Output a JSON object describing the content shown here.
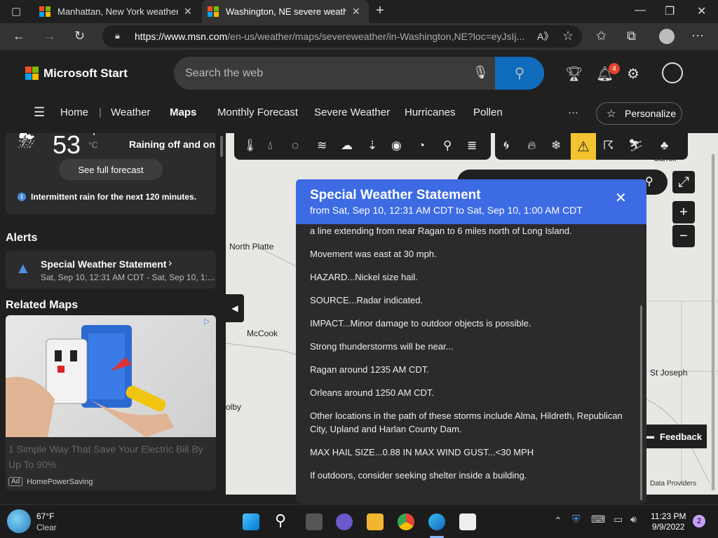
{
  "browser": {
    "tabs": [
      {
        "title": "Manhattan, New York weather fo",
        "active": false
      },
      {
        "title": "Washington, NE severe weather",
        "active": true
      }
    ],
    "new_tab": "+",
    "url_host": "https://www.msn.com",
    "url_path": "/en-us/weather/maps/severeweather/in-Washington,NE?loc=eyJsIj..."
  },
  "header": {
    "brand": "Microsoft Start",
    "search_placeholder": "Search the web",
    "notifications_count": "4",
    "nav": [
      "Home",
      "Weather",
      "Maps",
      "Monthly Forecast",
      "Severe Weather",
      "Hurricanes",
      "Pollen"
    ],
    "nav_active": "Maps",
    "more": "···",
    "personalize": "Personalize"
  },
  "current": {
    "temp": "53",
    "unit_f": "°F",
    "unit_c": "°C",
    "condition": "Raining off and on",
    "forecast_button": "See full forecast",
    "rain_note": "Intermittent rain for the next 120 minutes."
  },
  "alerts": {
    "heading": "Alerts",
    "items": [
      {
        "title": "Special Weather Statement",
        "time": "Sat, Sep 10, 12:31 AM CDT - Sat, Sep 10, 1:..."
      }
    ]
  },
  "related": {
    "heading": "Related Maps",
    "ad_text": "1 Simple Way That Save Your Electric Bill By Up To 90%",
    "ad_badge": "Ad",
    "ad_source": "HomePowerSaving"
  },
  "map": {
    "cities": [
      "North Platte",
      "McCook",
      "olby",
      "St Joseph",
      "Carroll"
    ],
    "feedback": "Feedback",
    "data_providers": "Data Providers"
  },
  "dialog": {
    "title": "Special Weather Statement",
    "range": "from Sat, Sep 10, 12:31 AM CDT to Sat, Sep 10, 1:00 AM CDT",
    "paragraphs": [
      "a line extending from near Ragan to 6 miles north of Long Island.",
      "Movement was east at 30 mph.",
      "HAZARD...Nickel size hail.",
      "SOURCE...Radar indicated.",
      "IMPACT...Minor damage to outdoor objects is possible.",
      "Strong thunderstorms will be near...",
      "Ragan around 1235 AM CDT.",
      "Orleans around 1250 AM CDT.",
      "Other locations in the path of these storms include Alma, Hildreth, Republican City, Upland and Harlan County Dam.",
      "MAX HAIL SIZE...0.88 IN MAX WIND GUST...<30 MPH",
      "If outdoors, consider seeking shelter inside a building."
    ]
  },
  "taskbar": {
    "weather_temp": "67°F",
    "weather_cond": "Clear",
    "time": "11:23 PM",
    "date": "9/9/2022",
    "notifications": "2"
  },
  "colors": {
    "accent": "#3c6be4",
    "search_button": "#0f6cbd",
    "warning": "#f4c430"
  }
}
